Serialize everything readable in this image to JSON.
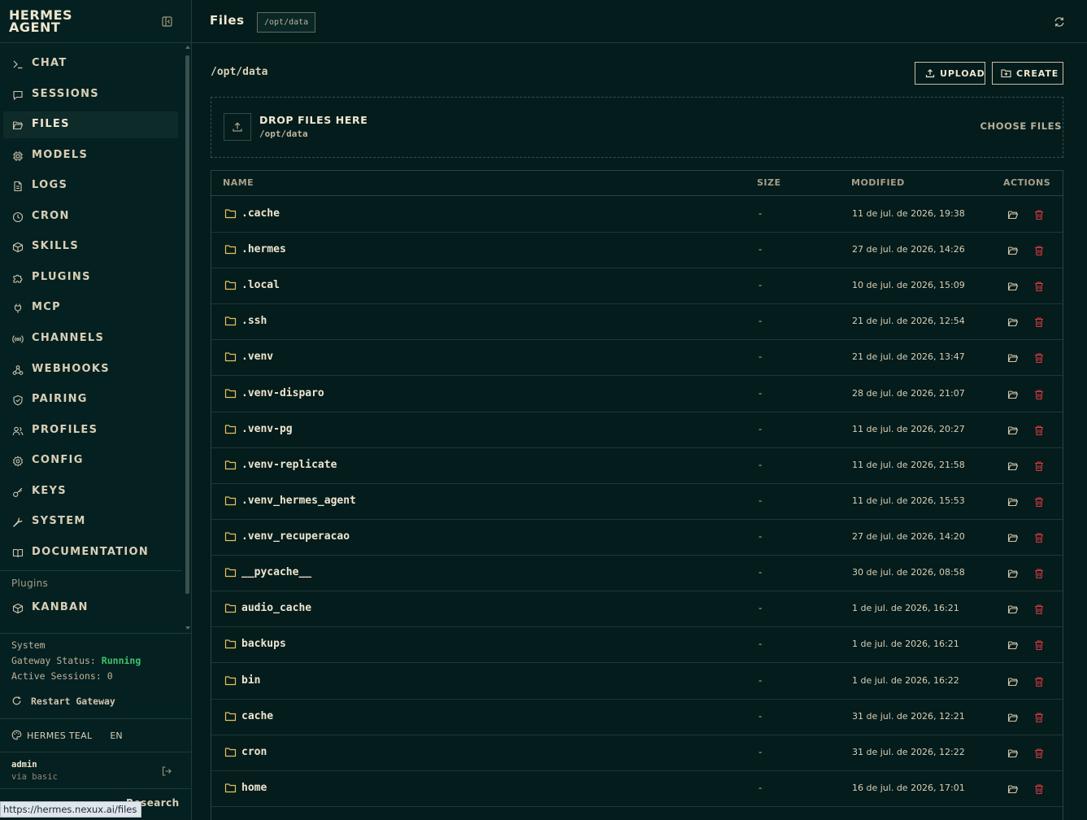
{
  "brand": {
    "line1": "HERMES",
    "line2": "AGENT"
  },
  "sidebar": {
    "items": [
      {
        "label": "CHAT",
        "icon": "terminal-icon"
      },
      {
        "label": "SESSIONS",
        "icon": "message-icon"
      },
      {
        "label": "FILES",
        "icon": "folder-open-icon",
        "active": true
      },
      {
        "label": "MODELS",
        "icon": "cpu-icon"
      },
      {
        "label": "LOGS",
        "icon": "file-text-icon"
      },
      {
        "label": "CRON",
        "icon": "clock-icon"
      },
      {
        "label": "SKILLS",
        "icon": "package-icon"
      },
      {
        "label": "PLUGINS",
        "icon": "puzzle-icon"
      },
      {
        "label": "MCP",
        "icon": "plug-icon"
      },
      {
        "label": "CHANNELS",
        "icon": "radio-icon"
      },
      {
        "label": "WEBHOOKS",
        "icon": "webhook-icon"
      },
      {
        "label": "PAIRING",
        "icon": "shield-check-icon"
      },
      {
        "label": "PROFILES",
        "icon": "users-icon"
      },
      {
        "label": "CONFIG",
        "icon": "settings-icon"
      },
      {
        "label": "KEYS",
        "icon": "key-icon"
      },
      {
        "label": "SYSTEM",
        "icon": "wrench-icon"
      },
      {
        "label": "DOCUMENTATION",
        "icon": "book-icon"
      }
    ],
    "plugins_heading": "Plugins",
    "plugin_items": [
      {
        "label": "KANBAN",
        "icon": "package-icon"
      }
    ],
    "system": {
      "heading": "System",
      "gateway_label": "Gateway Status:",
      "gateway_value": "Running",
      "sessions_label": "Active Sessions:",
      "sessions_value": "0",
      "restart_label": "Restart Gateway"
    },
    "theme": "HERMES TEAL",
    "language": "EN",
    "user": {
      "name": "admin",
      "sub": "via basic"
    },
    "research": "Research",
    "status_url": "https://hermes.nexux.ai/files"
  },
  "header": {
    "title": "Files",
    "path_chip": "/opt/data"
  },
  "main": {
    "current_path": "/opt/data",
    "upload_label": "UPLOAD",
    "create_label": "CREATE",
    "dropzone": {
      "title": "DROP FILES HERE",
      "path": "/opt/data",
      "choose": "CHOOSE FILES"
    },
    "columns": {
      "name": "NAME",
      "size": "SIZE",
      "modified": "MODIFIED",
      "actions": "ACTIONS"
    },
    "rows": [
      {
        "name": ".cache",
        "size": "-",
        "modified": "11 de jul. de 2026, 19:38"
      },
      {
        "name": ".hermes",
        "size": "-",
        "modified": "27 de jul. de 2026, 14:26"
      },
      {
        "name": ".local",
        "size": "-",
        "modified": "10 de jul. de 2026, 15:09"
      },
      {
        "name": ".ssh",
        "size": "-",
        "modified": "21 de jul. de 2026, 12:54"
      },
      {
        "name": ".venv",
        "size": "-",
        "modified": "21 de jul. de 2026, 13:47"
      },
      {
        "name": ".venv-disparo",
        "size": "-",
        "modified": "28 de jul. de 2026, 21:07"
      },
      {
        "name": ".venv-pg",
        "size": "-",
        "modified": "11 de jul. de 2026, 20:27"
      },
      {
        "name": ".venv-replicate",
        "size": "-",
        "modified": "11 de jul. de 2026, 21:58"
      },
      {
        "name": ".venv_hermes_agent",
        "size": "-",
        "modified": "11 de jul. de 2026, 15:53"
      },
      {
        "name": ".venv_recuperacao",
        "size": "-",
        "modified": "27 de jul. de 2026, 14:20"
      },
      {
        "name": "__pycache__",
        "size": "-",
        "modified": "30 de jul. de 2026, 08:58"
      },
      {
        "name": "audio_cache",
        "size": "-",
        "modified": "1 de jul. de 2026, 16:21"
      },
      {
        "name": "backups",
        "size": "-",
        "modified": "1 de jul. de 2026, 16:21"
      },
      {
        "name": "bin",
        "size": "-",
        "modified": "1 de jul. de 2026, 16:22"
      },
      {
        "name": "cache",
        "size": "-",
        "modified": "31 de jul. de 2026, 12:21"
      },
      {
        "name": "cron",
        "size": "-",
        "modified": "31 de jul. de 2026, 12:22"
      },
      {
        "name": "home",
        "size": "-",
        "modified": "16 de jul. de 2026, 17:01"
      }
    ]
  },
  "colors": {
    "background": "#041c1c",
    "text": "#e7dcc4",
    "folder": "#e8c15a",
    "delete": "#d8393f",
    "running": "#3ec46d"
  }
}
